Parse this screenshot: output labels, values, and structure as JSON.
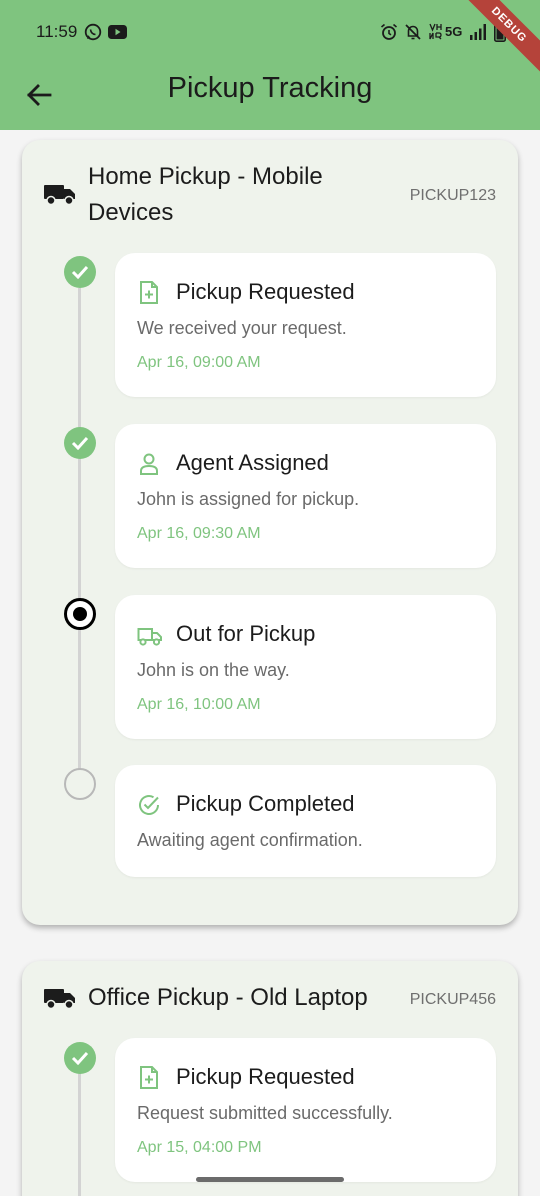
{
  "status_bar": {
    "time": "11:59",
    "network_label": "5G",
    "icons": [
      "whatsapp-icon",
      "youtube-icon",
      "alarm-icon",
      "bell-off-icon",
      "volte-icon",
      "5g-icon",
      "signal-icon",
      "battery-icon"
    ]
  },
  "app_bar": {
    "title": "Pickup Tracking",
    "back_icon": "arrow-left-icon",
    "debug_banner": "DEBUG"
  },
  "colors": {
    "primary": "#7fc47f",
    "card_bg": "#eff3ec",
    "step_bg": "#ffffff",
    "current": "#000000",
    "pending": "#b8b8b8",
    "debug": "#b5433a"
  },
  "pickups": [
    {
      "title": "Home Pickup - Mobile Devices",
      "id": "PICKUP123",
      "steps": [
        {
          "status": "done",
          "icon": "document-plus-icon",
          "title": "Pickup Requested",
          "description": "We received your request.",
          "time": "Apr 16, 09:00 AM"
        },
        {
          "status": "done",
          "icon": "person-icon",
          "title": "Agent Assigned",
          "description": "John is assigned for pickup.",
          "time": "Apr 16, 09:30 AM"
        },
        {
          "status": "current",
          "icon": "truck-icon",
          "title": "Out for Pickup",
          "description": "John is on the way.",
          "time": "Apr 16, 10:00 AM"
        },
        {
          "status": "pending",
          "icon": "check-circle-icon",
          "title": "Pickup Completed",
          "description": "Awaiting agent confirmation.",
          "time": ""
        }
      ]
    },
    {
      "title": "Office Pickup - Old Laptop",
      "id": "PICKUP456",
      "steps": [
        {
          "status": "done",
          "icon": "document-plus-icon",
          "title": "Pickup Requested",
          "description": "Request submitted successfully.",
          "time": "Apr 15, 04:00 PM"
        }
      ]
    }
  ]
}
